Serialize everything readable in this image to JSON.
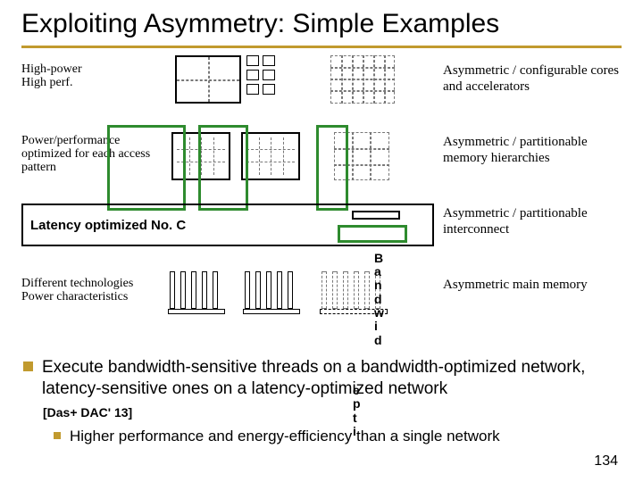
{
  "title": "Exploiting Asymmetry: Simple Examples",
  "rows": {
    "r1": {
      "left": "High-power\nHigh perf.",
      "right": "Asymmetric / configurable cores and accelerators"
    },
    "r2": {
      "left": "Power/performance optimized for each access pattern",
      "right": "Asymmetric / partitionable memory hierarchies"
    },
    "r3": {
      "noc_label": "Latency optimized No. C",
      "bw_label": "B\na\nn\nd\nw\ni\nd",
      "right": "Asymmetric / partitionable interconnect"
    },
    "r4": {
      "left": "Different technologies\nPower characteristics",
      "right": "Asymmetric main memory"
    }
  },
  "bullet_main": "Execute bandwidth-sensitive threads on a bandwidth-optimized network, latency-sensitive ones on a latency-optimized network",
  "citation": "[Das+ DAC' 13]",
  "bullet_sub": "Higher performance and energy-efficiency than a single network",
  "scatter1": "B\na\nn\nd\nw\ni\nd",
  "scatter2": "e\np\nt\ni",
  "page_number": "134"
}
